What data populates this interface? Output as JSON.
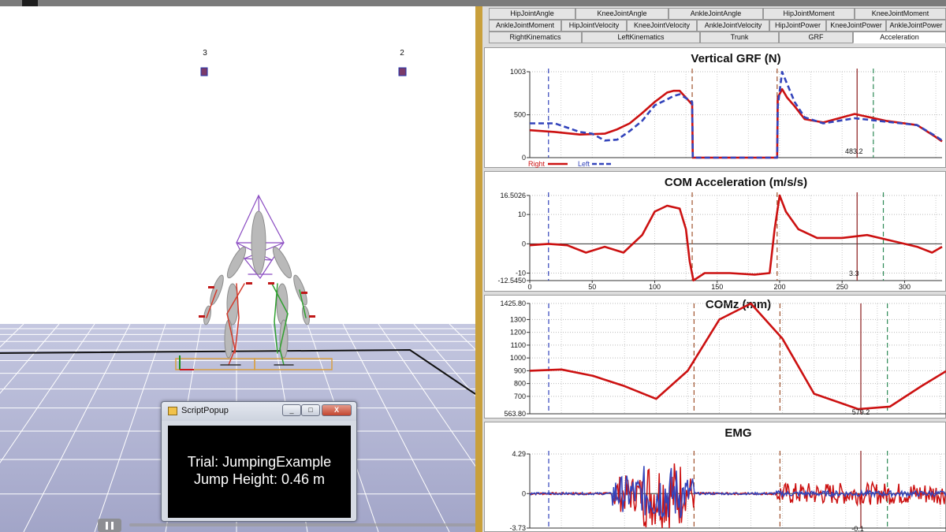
{
  "scene": {
    "marker_labels": [
      "3",
      "2"
    ]
  },
  "tabs": {
    "row1": [
      "HipJointAngle",
      "KneeJointAngle",
      "AnkleJointAngle",
      "HipJointMoment",
      "KneeJointMoment"
    ],
    "row2": [
      "AnkleJointMoment",
      "HipJointVelocity",
      "KneeJointVelocity",
      "AnkleJointVelocity",
      "HipJointPower",
      "KneeJointPower",
      "AnkleJointPower"
    ],
    "row3": [
      "RightKinematics",
      "LeftKinematics",
      "Trunk",
      "GRF",
      "Acceleration"
    ],
    "active": "Acceleration"
  },
  "popup": {
    "title": "ScriptPopup",
    "minimize": "_",
    "maximize": "□",
    "close": "X",
    "line1": "Trial: JumpingExample",
    "line2": "Jump Height: 0.46 m"
  },
  "colors": {
    "right_series": "#cc1111",
    "left_series": "#3344bb",
    "cursor": "#8b1a1a",
    "divider": "#c9a03c"
  },
  "chart_data": [
    {
      "type": "line",
      "title": "Vertical GRF (N)",
      "ytick_labels": [
        "1003",
        "500",
        "0"
      ],
      "ylim": [
        0,
        1003
      ],
      "xlim": [
        0,
        330
      ],
      "cursor_readout": "483.2",
      "legend": [
        "Right",
        "Left"
      ],
      "legend_position": "bottom-left",
      "series": [
        {
          "name": "Right",
          "x": [
            0,
            20,
            40,
            60,
            70,
            80,
            90,
            100,
            110,
            115,
            120,
            130,
            130.5,
            198,
            198.5,
            202,
            206,
            212,
            220,
            235,
            260,
            285,
            310,
            325,
            330
          ],
          "y": [
            320,
            300,
            270,
            280,
            330,
            400,
            520,
            650,
            760,
            780,
            780,
            620,
            0,
            0,
            700,
            800,
            700,
            600,
            450,
            410,
            510,
            430,
            380,
            240,
            190
          ]
        },
        {
          "name": "Left",
          "x": [
            0,
            20,
            40,
            50,
            60,
            70,
            80,
            90,
            100,
            110,
            115,
            120,
            130,
            130.5,
            198,
            198.5,
            202,
            206,
            212,
            220,
            235,
            260,
            285,
            310,
            325,
            330
          ],
          "y": [
            400,
            400,
            300,
            280,
            200,
            210,
            310,
            430,
            610,
            680,
            720,
            740,
            650,
            0,
            0,
            600,
            1000,
            860,
            650,
            470,
            400,
            460,
            420,
            380,
            250,
            200
          ]
        }
      ]
    },
    {
      "type": "line",
      "title": "COM Acceleration (m/s/s)",
      "ytick_labels": [
        "16.5026",
        "10",
        "0",
        "-10",
        "-12.5450"
      ],
      "xtick_labels": [
        "0",
        "50",
        "100",
        "150",
        "200",
        "250",
        "300"
      ],
      "ylim": [
        -12.545,
        16.5026
      ],
      "xlim": [
        0,
        330
      ],
      "cursor_readout": "3.3",
      "series": [
        {
          "name": "Right",
          "x": [
            0,
            15,
            30,
            45,
            60,
            75,
            90,
            100,
            110,
            120,
            125,
            128,
            131,
            140,
            160,
            180,
            192,
            196,
            200,
            205,
            215,
            230,
            250,
            270,
            290,
            310,
            322,
            330
          ],
          "y": [
            -0.5,
            0,
            -0.5,
            -3,
            -1,
            -3,
            3,
            11,
            13,
            12,
            5,
            -6,
            -12.5,
            -10,
            -10,
            -10.5,
            -10,
            5,
            16.5,
            11,
            5,
            2,
            2,
            3,
            1,
            -1,
            -3,
            -1
          ]
        }
      ]
    },
    {
      "type": "line",
      "title": "COMz (mm)",
      "ytick_labels": [
        "1425.80",
        "1300",
        "1200",
        "1100",
        "1000",
        "900",
        "800",
        "700",
        "563.80"
      ],
      "ylim": [
        563.8,
        1425.8
      ],
      "xlim": [
        0,
        330
      ],
      "cursor_readout": "579.2",
      "series": [
        {
          "name": "Right",
          "x": [
            0,
            25,
            50,
            75,
            100,
            125,
            150,
            175,
            200,
            225,
            260,
            285,
            310,
            330
          ],
          "y": [
            900,
            910,
            860,
            780,
            680,
            900,
            1300,
            1425,
            1150,
            720,
            600,
            620,
            780,
            900
          ]
        }
      ]
    },
    {
      "type": "line",
      "title": "EMG",
      "ytick_labels": [
        "4.29",
        "0",
        "-3.73"
      ],
      "ylim": [
        -3.73,
        4.29
      ],
      "xlim": [
        0,
        330
      ],
      "cursor_readout": "-0.1",
      "series": [
        {
          "name": "Right",
          "x": [],
          "y": []
        },
        {
          "name": "Left",
          "x": [],
          "y": []
        }
      ]
    }
  ]
}
